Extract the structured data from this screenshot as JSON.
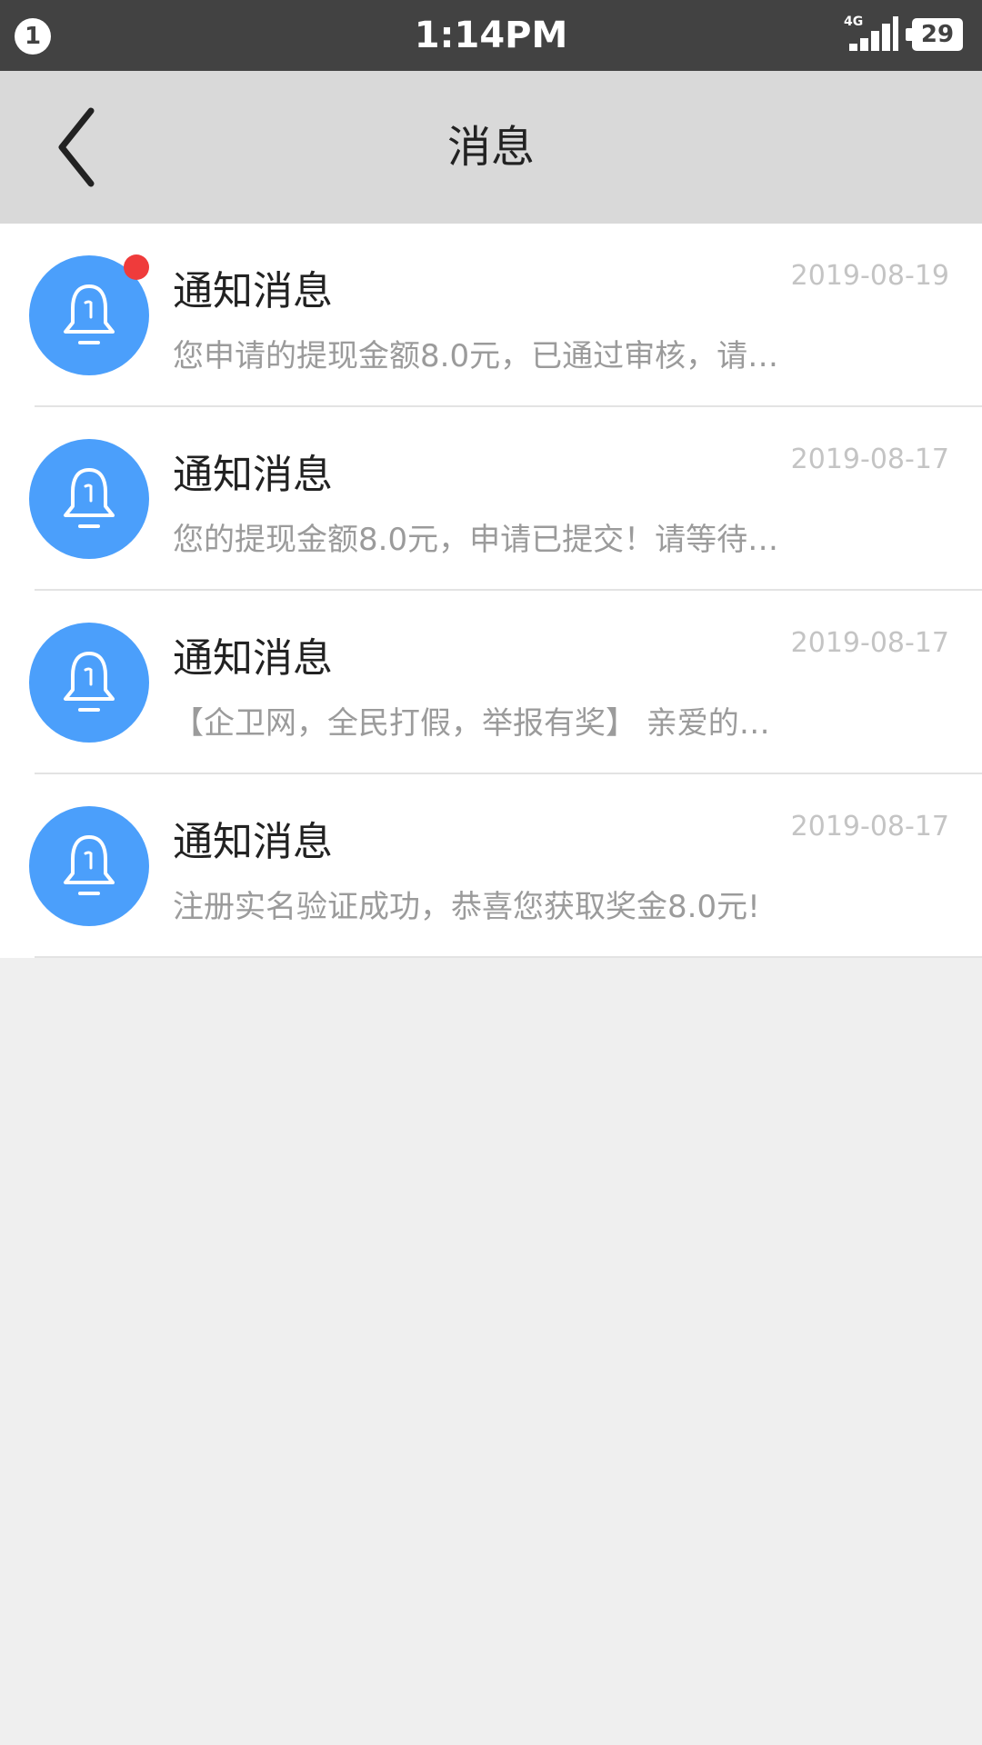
{
  "status_bar": {
    "notification_count": "1",
    "time": "1:14PM",
    "network": "4G",
    "battery": "29",
    "signal_icon": "signal-bars-icon",
    "battery_icon": "battery-icon"
  },
  "header": {
    "title": "消息",
    "back_icon": "chevron-left-icon"
  },
  "colors": {
    "status_bar": "#424242",
    "header": "#d9d9d9",
    "avatar": "#4b9ffb",
    "unread_dot": "#ef3b3b",
    "page_background": "#efefef"
  },
  "messages": [
    {
      "title": "通知消息",
      "date": "2019-08-19",
      "preview": "您申请的提现金额8.0元，已通过审核，请…",
      "icon": "bell-icon",
      "unread": true
    },
    {
      "title": "通知消息",
      "date": "2019-08-17",
      "preview": "您的提现金额8.0元，申请已提交！请等待…",
      "icon": "bell-icon",
      "unread": false
    },
    {
      "title": "通知消息",
      "date": "2019-08-17",
      "preview": "【企卫网，全民打假，举报有奖】 亲爱的…",
      "icon": "bell-icon",
      "unread": false
    },
    {
      "title": "通知消息",
      "date": "2019-08-17",
      "preview": "注册实名验证成功，恭喜您获取奖金8.0元!",
      "icon": "bell-icon",
      "unread": false
    }
  ]
}
